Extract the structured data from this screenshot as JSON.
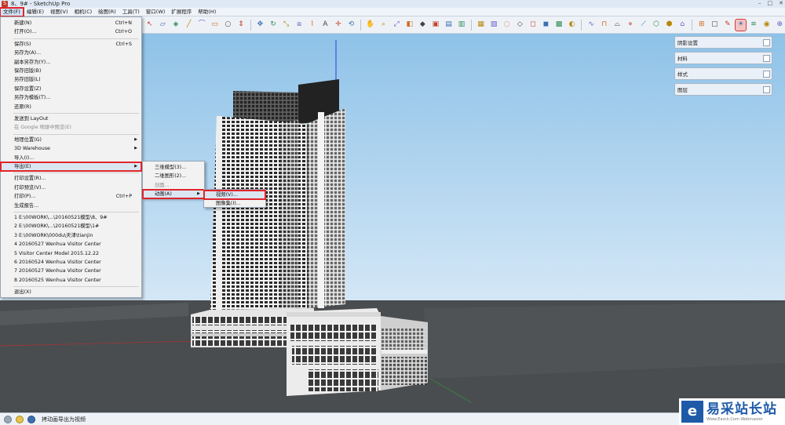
{
  "window": {
    "title": "8、9# - SketchUp Pro",
    "app_icon": "sketchup-logo-icon",
    "controls": [
      "–",
      "□",
      "✕"
    ]
  },
  "menubar": {
    "items": [
      "文件(F)",
      "编辑(E)",
      "视图(V)",
      "相机(C)",
      "绘图(R)",
      "工具(T)",
      "窗口(W)",
      "扩展程序",
      "帮助(H)"
    ],
    "active_index": 0
  },
  "toolbar": {
    "icons": [
      "select-icon",
      "eraser-icon",
      "paint-bucket-icon",
      "line-icon",
      "arc-icon",
      "rectangle-icon",
      "circle-icon",
      "push-pull-icon",
      "move-icon",
      "rotate-icon",
      "scale-icon",
      "offset-icon",
      "tape-measure-icon",
      "text-icon",
      "axes-icon",
      "orbit-icon",
      "pan-icon",
      "zoom-icon",
      "zoom-extents-icon",
      "section-plane-icon",
      "iso-view-icon",
      "top-view-icon",
      "front-view-icon",
      "right-view-icon",
      "back-view-icon",
      "left-view-icon",
      "xray-icon",
      "wireframe-icon",
      "hidden-line-icon",
      "shaded-icon",
      "textured-icon",
      "monochrome-icon",
      "sandbox-smoove-icon",
      "sandbox-stamp-icon",
      "sandbox-drape-icon",
      "sandbox-add-detail-icon",
      "sandbox-flip-edge-icon",
      "component-icon",
      "group-icon",
      "warehouse-icon",
      "extension-warehouse-icon",
      "layout-icon",
      "style-builder-icon",
      "shadow-icon",
      "fog-icon",
      "sketchup-ruby-icon",
      "solid-tools-icon"
    ]
  },
  "tray": {
    "panels": [
      "阴影设置",
      "材料",
      "样式",
      "图层"
    ]
  },
  "file_menu": {
    "items": [
      {
        "label": "新建(N)",
        "shortcut": "Ctrl+N"
      },
      {
        "label": "打开(O)...",
        "shortcut": "Ctrl+O"
      },
      {
        "sep": true
      },
      {
        "label": "保存(S)",
        "shortcut": "Ctrl+S"
      },
      {
        "label": "另存为(A)..."
      },
      {
        "label": "副本另存为(Y)..."
      },
      {
        "label": "保存旧版(B)"
      },
      {
        "label": "另存旧版(L)"
      },
      {
        "label": "保存设置(Z)"
      },
      {
        "label": "另存为模板(T)..."
      },
      {
        "label": "还原(R)"
      },
      {
        "sep": true
      },
      {
        "label": "发送到 LayOut"
      },
      {
        "label": "在 Google 地球中预览(E)",
        "disabled": true
      },
      {
        "sep": true
      },
      {
        "label": "地理位置(G)",
        "submenu": true
      },
      {
        "label": "3D Warehouse",
        "submenu": true
      },
      {
        "label": "导入(I)..."
      },
      {
        "label": "导出(E)",
        "submenu": true,
        "highlight": true
      },
      {
        "sep": true
      },
      {
        "label": "打印设置(R)..."
      },
      {
        "label": "打印预览(V)..."
      },
      {
        "label": "打印(P)...",
        "shortcut": "Ctrl+P"
      },
      {
        "label": "生成报告..."
      },
      {
        "sep": true
      },
      {
        "label": "1 E:\\00WORK\\...\\20160521模型\\8、9#"
      },
      {
        "label": "2 E:\\00WORK\\...\\20160521模型\\1#"
      },
      {
        "label": "3 E:\\00WORK\\000du\\天津\\tianjin"
      },
      {
        "label": "4 20160527 Wenhua Visitor Center"
      },
      {
        "label": "5 Visitor Center Model 2015.12.22"
      },
      {
        "label": "6 20160524 Wenhua Visitor Center"
      },
      {
        "label": "7 20160527 Wenhua Visitor Center"
      },
      {
        "label": "8 20160525 Wenhua Visitor Center"
      },
      {
        "sep": true
      },
      {
        "label": "退出(X)"
      }
    ]
  },
  "export_submenu": {
    "items": [
      {
        "label": "三维模型(3)..."
      },
      {
        "label": "二维图形(2)..."
      },
      {
        "label": "剖面...",
        "disabled": true
      },
      {
        "label": "动画(A)",
        "submenu": true,
        "highlight": true
      }
    ]
  },
  "animation_submenu": {
    "items": [
      {
        "label": "视频(V)...",
        "highlight": true
      },
      {
        "label": "图像集(I)..."
      }
    ]
  },
  "statusbar": {
    "icons": [
      "geo-location-icon",
      "credits-icon",
      "user-icon"
    ],
    "text": "拷动画导出为视频"
  },
  "watermark": {
    "mark": "e",
    "cn": "易采站长站",
    "en": "Www.Easck.Com Webmaster"
  },
  "colors": {
    "sky_top": "#8ec2e8",
    "sky_bottom": "#d4e7f6",
    "ground": "#4a4d50",
    "highlight_red": "#e0252a"
  }
}
